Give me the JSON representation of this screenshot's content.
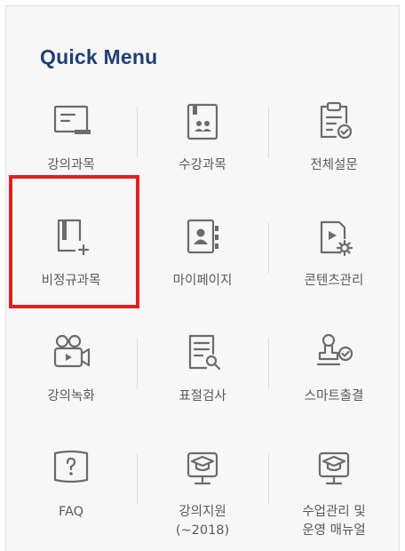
{
  "title": "Quick Menu",
  "items": [
    {
      "label": "강의과목",
      "icon": "lecture-screen-icon"
    },
    {
      "label": "수강과목",
      "icon": "student-book-icon"
    },
    {
      "label": "전체설문",
      "icon": "clipboard-check-icon"
    },
    {
      "label": "비정규과목",
      "icon": "book-plus-icon"
    },
    {
      "label": "마이페이지",
      "icon": "contact-book-icon"
    },
    {
      "label": "콘텐츠관리",
      "icon": "video-settings-icon"
    },
    {
      "label": "강의녹화",
      "icon": "video-camera-icon"
    },
    {
      "label": "표절검사",
      "icon": "document-search-icon"
    },
    {
      "label": "스마트출결",
      "icon": "stamp-check-icon"
    },
    {
      "label": "FAQ",
      "icon": "question-book-icon"
    },
    {
      "label": "강의지원",
      "label2": "(~2018)",
      "icon": "graduation-monitor-icon"
    },
    {
      "label": "수업관리 및",
      "label2": "운영 매뉴얼",
      "icon": "graduation-monitor-icon"
    }
  ],
  "highlight_color": "#e02020",
  "title_color": "#1f3f76"
}
